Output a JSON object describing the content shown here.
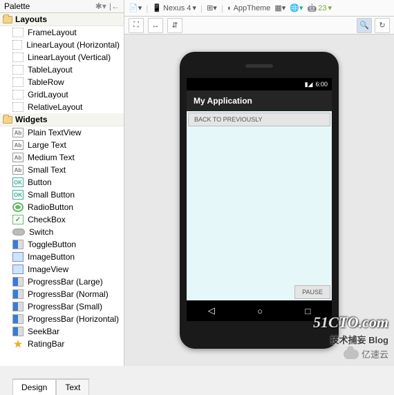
{
  "palette": {
    "title": "Palette",
    "categories": [
      {
        "label": "Layouts",
        "items": [
          {
            "label": "FrameLayout",
            "icon": "plain"
          },
          {
            "label": "LinearLayout (Horizontal)",
            "icon": "plain"
          },
          {
            "label": "LinearLayout (Vertical)",
            "icon": "plain"
          },
          {
            "label": "TableLayout",
            "icon": "plain"
          },
          {
            "label": "TableRow",
            "icon": "plain"
          },
          {
            "label": "GridLayout",
            "icon": "plain"
          },
          {
            "label": "RelativeLayout",
            "icon": "plain"
          }
        ]
      },
      {
        "label": "Widgets",
        "items": [
          {
            "label": "Plain TextView",
            "icon": "ab",
            "glyph": "Ab"
          },
          {
            "label": "Large Text",
            "icon": "ab",
            "glyph": "Ab"
          },
          {
            "label": "Medium Text",
            "icon": "ab",
            "glyph": "Ab"
          },
          {
            "label": "Small Text",
            "icon": "ab",
            "glyph": "Ab"
          },
          {
            "label": "Button",
            "icon": "ok",
            "glyph": "OK"
          },
          {
            "label": "Small Button",
            "icon": "ok",
            "glyph": "OK"
          },
          {
            "label": "RadioButton",
            "icon": "radio"
          },
          {
            "label": "CheckBox",
            "icon": "check"
          },
          {
            "label": "Switch",
            "icon": "switch"
          },
          {
            "label": "ToggleButton",
            "icon": "bar"
          },
          {
            "label": "ImageButton",
            "icon": "img"
          },
          {
            "label": "ImageView",
            "icon": "img"
          },
          {
            "label": "ProgressBar (Large)",
            "icon": "bar"
          },
          {
            "label": "ProgressBar (Normal)",
            "icon": "bar"
          },
          {
            "label": "ProgressBar (Small)",
            "icon": "bar"
          },
          {
            "label": "ProgressBar (Horizontal)",
            "icon": "bar"
          },
          {
            "label": "SeekBar",
            "icon": "bar"
          },
          {
            "label": "RatingBar",
            "icon": "star",
            "glyph": "★"
          }
        ]
      }
    ]
  },
  "toolbar": {
    "device": "Nexus 4",
    "theme": "AppTheme",
    "api": "23"
  },
  "app": {
    "status_time": "6:00",
    "title": "My Application",
    "button1": "BACK TO PREVIOUSLY",
    "button2": "PAUSE"
  },
  "tabs": {
    "design": "Design",
    "text": "Text",
    "active": "design"
  },
  "watermark": {
    "line1": "51CTO.com",
    "line2": "技术捕妄   Blog",
    "line3": "亿速云"
  }
}
